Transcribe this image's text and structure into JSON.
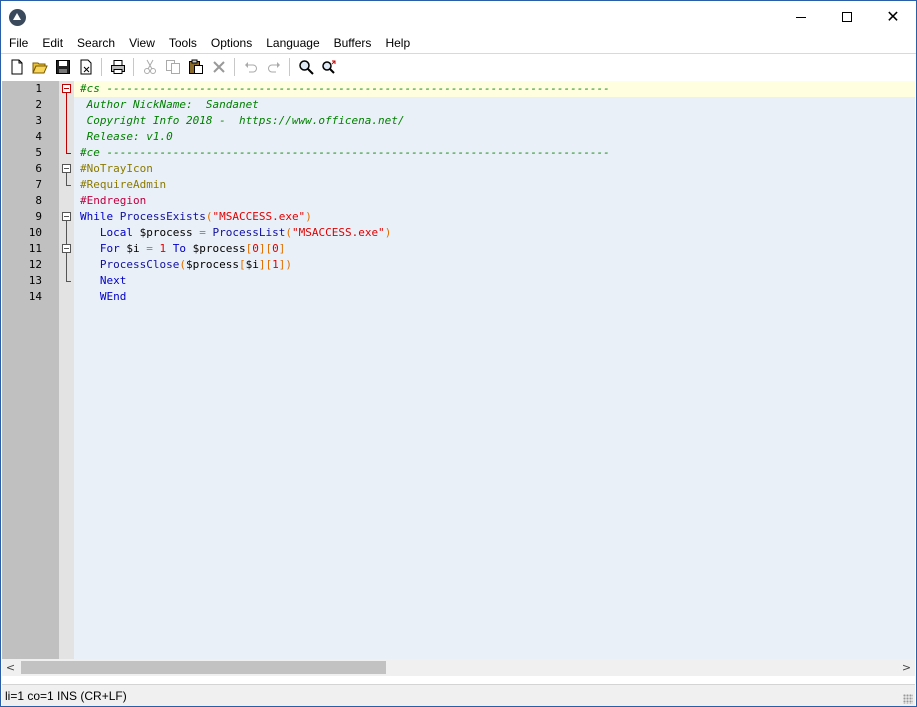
{
  "menu": [
    "File",
    "Edit",
    "Search",
    "View",
    "Tools",
    "Options",
    "Language",
    "Buffers",
    "Help"
  ],
  "toolbar_icons": [
    "new-file-icon",
    "open-folder-icon",
    "save-icon",
    "close-file-icon",
    "print-icon",
    "cut-icon",
    "copy-icon",
    "paste-icon",
    "delete-icon",
    "undo-icon",
    "redo-icon",
    "find-icon",
    "replace-icon"
  ],
  "colors": {
    "comment": "#008000",
    "directive": "#8a7a00",
    "region": "#c00040",
    "keyword": "#0000c8",
    "string": "#e00000",
    "operator": "#e07000",
    "current_line": "#ffffe0",
    "editor_bg": "#eaf0f7",
    "gutter_bg": "#c0c0c0"
  },
  "editor": {
    "lines": [
      {
        "n": "1",
        "tokens": [
          {
            "t": "#cs ----------------------------------------------------------------------------",
            "k": "comment"
          }
        ]
      },
      {
        "n": "2",
        "tokens": [
          {
            "t": " Author NickName:  Sandanet",
            "k": "comment"
          }
        ]
      },
      {
        "n": "3",
        "tokens": [
          {
            "t": " Copyright Info 2018 -  https://www.officena.net/",
            "k": "comment"
          }
        ]
      },
      {
        "n": "4",
        "tokens": [
          {
            "t": " Release: v1.0",
            "k": "comment"
          }
        ]
      },
      {
        "n": "5",
        "tokens": [
          {
            "t": "#ce ----------------------------------------------------------------------------",
            "k": "comment"
          }
        ]
      },
      {
        "n": "6",
        "tokens": [
          {
            "t": "#NoTrayIcon",
            "k": "dir"
          }
        ]
      },
      {
        "n": "7",
        "tokens": [
          {
            "t": "#RequireAdmin",
            "k": "dir"
          }
        ]
      },
      {
        "n": "8",
        "tokens": [
          {
            "t": "#Endregion",
            "k": "region"
          }
        ]
      },
      {
        "n": "9",
        "tokens": [
          {
            "t": "While ",
            "k": "kw"
          },
          {
            "t": "ProcessExists",
            "k": "fn"
          },
          {
            "t": "(",
            "k": "op"
          },
          {
            "t": "\"MSACCESS.exe\"",
            "k": "str"
          },
          {
            "t": ")",
            "k": "op"
          }
        ]
      },
      {
        "n": "10",
        "tokens": [
          {
            "t": "   ",
            "k": "plain"
          },
          {
            "t": "Local ",
            "k": "kw"
          },
          {
            "t": "$process ",
            "k": "var"
          },
          {
            "t": "= ",
            "k": "op"
          },
          {
            "t": "ProcessList",
            "k": "fn"
          },
          {
            "t": "(",
            "k": "op"
          },
          {
            "t": "\"MSACCESS.exe\"",
            "k": "str"
          },
          {
            "t": ")",
            "k": "op"
          }
        ]
      },
      {
        "n": "11",
        "tokens": [
          {
            "t": "   ",
            "k": "plain"
          },
          {
            "t": "For ",
            "k": "kw"
          },
          {
            "t": "$i ",
            "k": "var"
          },
          {
            "t": "= ",
            "k": "op"
          },
          {
            "t": "1 ",
            "k": "num"
          },
          {
            "t": "To ",
            "k": "kw"
          },
          {
            "t": "$process",
            "k": "var"
          },
          {
            "t": "[",
            "k": "op"
          },
          {
            "t": "0",
            "k": "num"
          },
          {
            "t": "][",
            "k": "op"
          },
          {
            "t": "0",
            "k": "num"
          },
          {
            "t": "]",
            "k": "op"
          }
        ]
      },
      {
        "n": "12",
        "tokens": [
          {
            "t": "   ",
            "k": "plain"
          },
          {
            "t": "ProcessClose",
            "k": "fn"
          },
          {
            "t": "(",
            "k": "op"
          },
          {
            "t": "$process",
            "k": "var"
          },
          {
            "t": "[",
            "k": "op"
          },
          {
            "t": "$i",
            "k": "var"
          },
          {
            "t": "][",
            "k": "op"
          },
          {
            "t": "1",
            "k": "num"
          },
          {
            "t": "])",
            "k": "op"
          }
        ]
      },
      {
        "n": "13",
        "tokens": [
          {
            "t": "   ",
            "k": "plain"
          },
          {
            "t": "Next",
            "k": "kw"
          }
        ]
      },
      {
        "n": "14",
        "tokens": [
          {
            "t": "   ",
            "k": "plain"
          },
          {
            "t": "WEnd",
            "k": "kw"
          }
        ]
      }
    ]
  },
  "status": {
    "text": "li=1 co=1 INS (CR+LF)"
  }
}
